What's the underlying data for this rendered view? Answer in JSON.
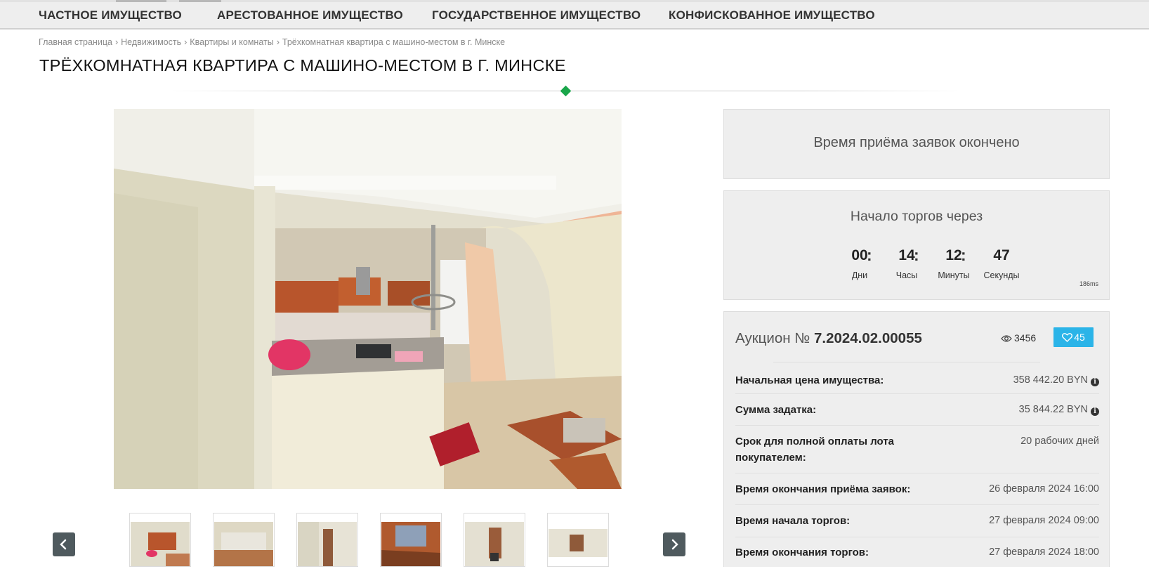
{
  "nav": {
    "items": [
      "ЧАСТНОЕ ИМУЩЕСТВО",
      "АРЕСТОВАННОЕ ИМУЩЕСТВО",
      "ГОСУДАРСТВЕННОЕ ИМУЩЕСТВО",
      "КОНФИСКОВАННОЕ ИМУЩЕСТВО"
    ]
  },
  "breadcrumb": {
    "items": [
      "Главная страница",
      "Недвижимость",
      "Квартиры и комнаты",
      "Трёхкомнатная квартира с машино-местом в г. Минске"
    ],
    "separator": "›"
  },
  "page": {
    "title": "ТРЁХКОМНАТНАЯ КВАРТИРА С МАШИНО-МЕСТОМ В Г. МИНСКЕ",
    "accent_color": "#1aa64a"
  },
  "gallery": {
    "main_image": "apartment-kitchen-photo",
    "thumbnails_count": 6,
    "prev_icon": "chevron-left-icon",
    "next_icon": "chevron-right-icon"
  },
  "application_status": {
    "message": "Время приёма заявок окончено"
  },
  "countdown": {
    "title": "Начало торгов через",
    "days": "00",
    "hours": "14",
    "minutes": "12",
    "seconds": "47",
    "days_label": "Дни",
    "hours_label": "Часы",
    "minutes_label": "Минуты",
    "seconds_label": "Секунды",
    "separator": ":",
    "ms": "186ms"
  },
  "auction": {
    "label": "Аукцион №",
    "number": "7.2024.02.00055",
    "views": "3456",
    "favorites": "45",
    "fav_color": "#2bb4e8",
    "rows": [
      {
        "key": "Начальная цена имущества:",
        "value": "358 442.20 BYN"
      },
      {
        "key": "Сумма задатка:",
        "value": "35 844.22 BYN"
      },
      {
        "key": "Срок для полной оплаты лота покупателем:",
        "value": "20 рабочих дней"
      },
      {
        "key": "Время окончания приёма заявок:",
        "value": "26 февраля 2024 16:00"
      },
      {
        "key": "Время начала торгов:",
        "value": "27 февраля 2024 09:00"
      },
      {
        "key": "Время окончания торгов:",
        "value": "27 февраля 2024 18:00"
      }
    ]
  }
}
